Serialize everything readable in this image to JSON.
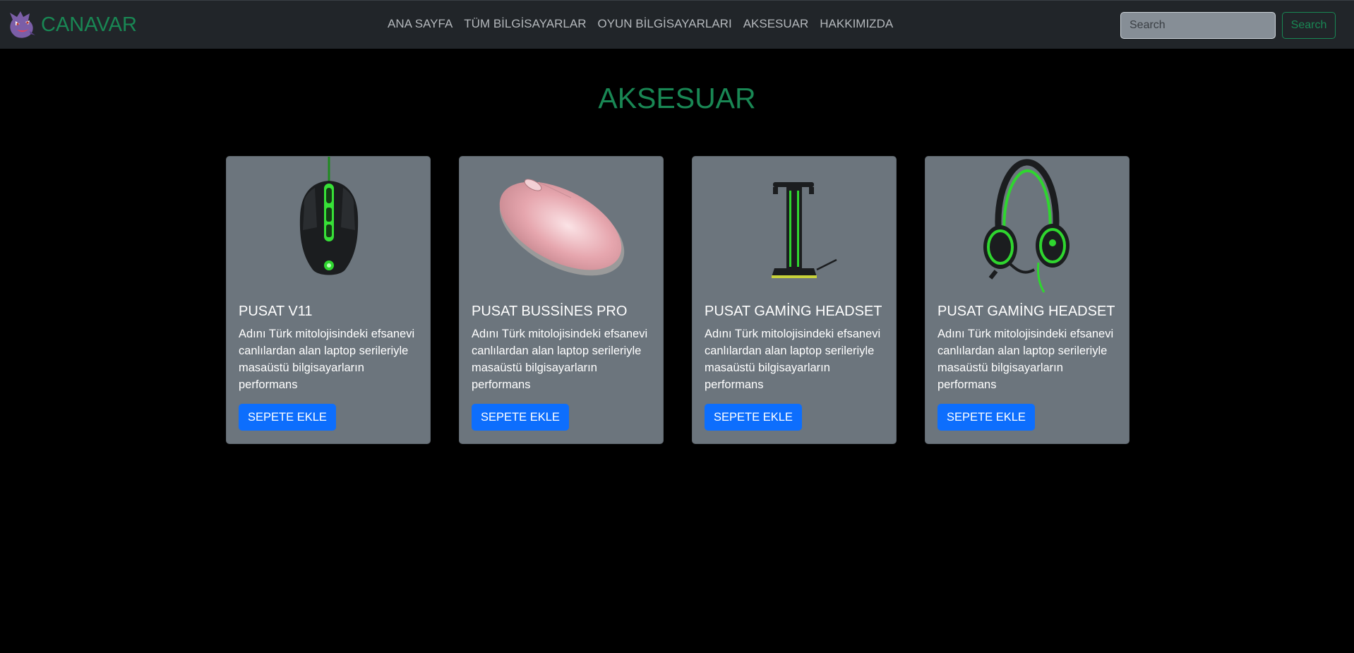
{
  "brand": {
    "name": "CANAVAR",
    "logo_icon": "monster-logo-icon"
  },
  "nav": {
    "links": [
      "ANA SAYFA",
      "TÜM BİLGİSAYARLAR",
      "OYUN BİLGİSAYARLARI",
      "AKSESUAR",
      "HAKKIMIZDA"
    ]
  },
  "search": {
    "placeholder": "Search",
    "value": "",
    "button_label": "Search"
  },
  "main": {
    "title": "AKSESUAR"
  },
  "products": [
    {
      "name": "PUSAT V11",
      "description": "Adını Türk mitolojisindeki efsanevi canlılardan alan laptop serileriyle masaüstü bilgisayarların performans",
      "button_label": "SEPETE EKLE",
      "image_icon": "gaming-mouse-image"
    },
    {
      "name": "PUSAT BUSSİNES PRO",
      "description": "Adını Türk mitolojisindeki efsanevi canlılardan alan laptop serileriyle masaüstü bilgisayarların performans",
      "button_label": "SEPETE EKLE",
      "image_icon": "pink-mouse-image"
    },
    {
      "name": "PUSAT GAMİNG HEADSET",
      "description": "Adını Türk mitolojisindeki efsanevi canlılardan alan laptop serileriyle masaüstü bilgisayarların performans",
      "button_label": "SEPETE EKLE",
      "image_icon": "headset-stand-image"
    },
    {
      "name": "PUSAT GAMİNG HEADSET",
      "description": "Adını Türk mitolojisindeki efsanevi canlılardan alan laptop serileriyle masaüstü bilgisayarların performans",
      "button_label": "SEPETE EKLE",
      "image_icon": "headset-image"
    }
  ],
  "colors": {
    "navbar_bg": "#212529",
    "brand": "#198754",
    "page_bg": "#000000",
    "card_bg": "#6c757d",
    "button_primary": "#0d6efd",
    "accent_green": "#2fd62f"
  }
}
